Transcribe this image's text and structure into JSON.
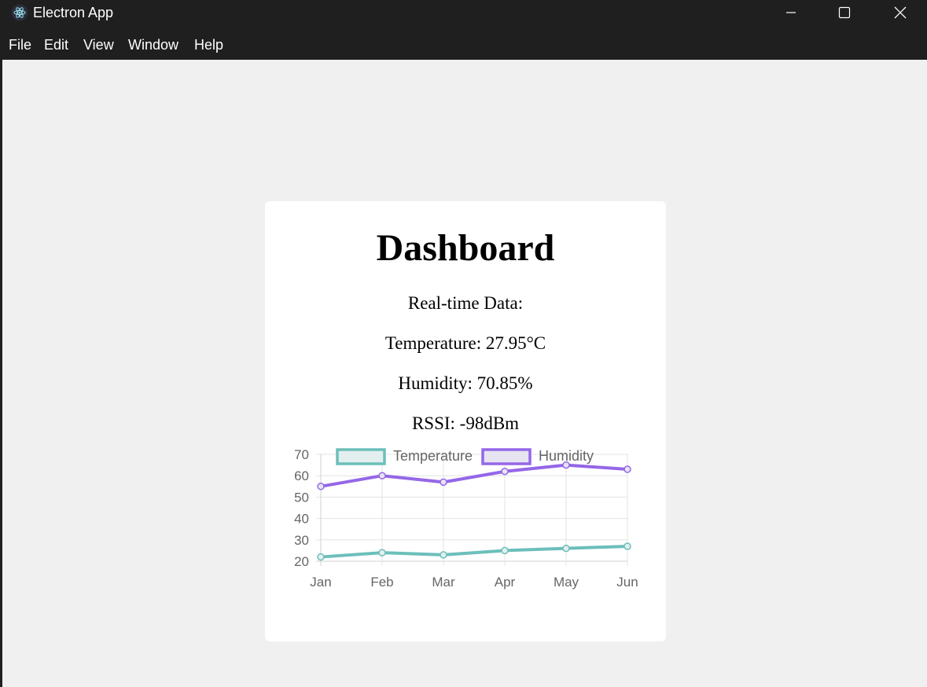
{
  "window": {
    "title": "Electron App"
  },
  "menu": [
    "File",
    "Edit",
    "View",
    "Window",
    "Help"
  ],
  "dashboard": {
    "title": "Dashboard",
    "realtime_label": "Real-time Data:",
    "temperature": "Temperature: 27.95°C",
    "humidity": "Humidity: 70.85%",
    "rssi": "RSSI: -98dBm"
  },
  "colors": {
    "temperature": "#6cbfba",
    "temperature_fill": "#e3eeee",
    "humidity": "#9467e8",
    "humidity_fill": "#e7e4f1",
    "grid": "#e3e3e3",
    "axis": "#d0d0d0"
  },
  "chart_data": {
    "type": "line",
    "categories": [
      "Jan",
      "Feb",
      "Mar",
      "Apr",
      "May",
      "Jun"
    ],
    "series": [
      {
        "name": "Temperature",
        "values": [
          22,
          24,
          23,
          25,
          26,
          27
        ]
      },
      {
        "name": "Humidity",
        "values": [
          55,
          60,
          57,
          62,
          65,
          63
        ]
      }
    ],
    "y_ticks": [
      20,
      30,
      40,
      50,
      60,
      70
    ],
    "ylim": [
      20,
      70
    ],
    "grid": true,
    "legend": "top"
  }
}
